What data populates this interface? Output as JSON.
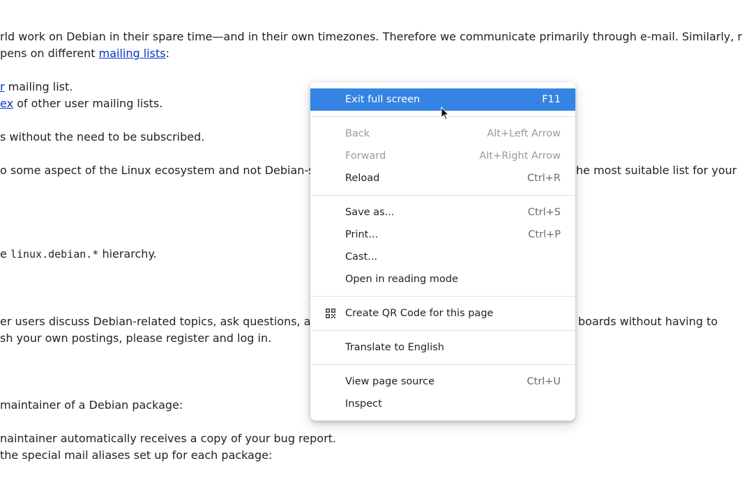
{
  "background": {
    "lines": [
      {
        "parts": [
          {
            "t": "rld work on Debian in their spare time—and in their own timezones. Therefore we communicate primarily through e-mail. Similarly, most of"
          }
        ]
      },
      {
        "parts": [
          {
            "t": "pens on different "
          },
          {
            "t": "mailing lists",
            "link": true
          },
          {
            "t": ":"
          }
        ]
      },
      {
        "parts": [
          {
            "t": "r",
            "link": true
          },
          {
            "t": " mailing list."
          }
        ]
      },
      {
        "parts": [
          {
            "t": "ex",
            "link": true
          },
          {
            "t": " of other user mailing lists."
          }
        ]
      },
      {
        "parts": [
          {
            "t": "s without the need to be subscribed."
          }
        ]
      },
      {
        "parts": [
          {
            "t": "o some aspect of the Linux ecosystem and not Debian-specif"
          }
        ]
      },
      {
        "parts": [
          {
            "t": "he most suitable list for your"
          }
        ]
      },
      {
        "parts": [
          {
            "t": "e "
          },
          {
            "t": "linux.debian.*",
            "code": true
          },
          {
            "t": " hierarchy."
          }
        ]
      },
      {
        "parts": [
          {
            "t": "er users discuss Debian-related topics, ask questions, and he"
          }
        ]
      },
      {
        "parts": [
          {
            "t": "boards without having to"
          }
        ]
      },
      {
        "parts": [
          {
            "t": "sh your own postings, please register and log in."
          }
        ]
      },
      {
        "parts": [
          {
            "t": "maintainer of a Debian package:"
          }
        ]
      },
      {
        "parts": [
          {
            "t": "naintainer automatically receives a copy of your bug report."
          }
        ]
      },
      {
        "parts": [
          {
            "t": " the special mail aliases set up for each package:"
          }
        ]
      }
    ]
  },
  "context_menu": {
    "groups": [
      [
        {
          "label": "Exit full screen",
          "shortcut": "F11",
          "state": "highlighted"
        }
      ],
      [
        {
          "label": "Back",
          "shortcut": "Alt+Left Arrow",
          "state": "disabled"
        },
        {
          "label": "Forward",
          "shortcut": "Alt+Right Arrow",
          "state": "disabled"
        },
        {
          "label": "Reload",
          "shortcut": "Ctrl+R",
          "state": "normal"
        }
      ],
      [
        {
          "label": "Save as...",
          "shortcut": "Ctrl+S",
          "state": "normal"
        },
        {
          "label": "Print...",
          "shortcut": "Ctrl+P",
          "state": "normal"
        },
        {
          "label": "Cast...",
          "shortcut": "",
          "state": "normal"
        },
        {
          "label": "Open in reading mode",
          "shortcut": "",
          "state": "normal"
        }
      ],
      [
        {
          "label": "Create QR Code for this page",
          "shortcut": "",
          "state": "normal",
          "icon": "qr-code-icon"
        }
      ],
      [
        {
          "label": "Translate to English",
          "shortcut": "",
          "state": "normal"
        }
      ],
      [
        {
          "label": "View page source",
          "shortcut": "Ctrl+U",
          "state": "normal"
        },
        {
          "label": "Inspect",
          "shortcut": "",
          "state": "normal"
        }
      ]
    ]
  },
  "colors": {
    "highlight": "#3584e4",
    "link": "#0035c7",
    "text": "#222222"
  }
}
